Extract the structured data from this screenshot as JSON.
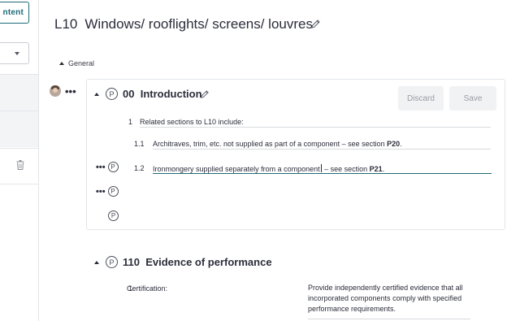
{
  "sidebar": {
    "top_button_label": "ntent"
  },
  "document": {
    "code": "L10",
    "title": "Windows/ rooflights/ screens/ louvres"
  },
  "group": {
    "label": "General"
  },
  "clause_intro": {
    "p_symbol": "P",
    "number": "00",
    "title": "Introduction",
    "discard_label": "Discard",
    "save_label": "Save",
    "item1_num": "1",
    "item1_text": "Related sections to L10 include:",
    "item11_num": "1.1",
    "item11_text": "Architraves, trim, etc. not supplied as part of a component – see section ",
    "item11_ref": "P20",
    "item11_end": ".",
    "item12_num": "1.2",
    "item12_text_a": "Ironmongery supplied separately from a component",
    "item12_text_b": " – see section ",
    "item12_ref": "P21",
    "item12_end": "."
  },
  "clause_110": {
    "p_symbol": "P",
    "number": "110",
    "title": "Evidence of performance",
    "item1_num": "1",
    "item1_label": "Certification:",
    "item1_text": "Provide independently certified evidence that all incorporated components comply with specified performance requirements."
  },
  "dots": "•••",
  "colors": {
    "accent": "#1f6a78",
    "text": "#2b2d3a",
    "border": "#e3e5ea",
    "button_bg": "#f1f2f4",
    "button_text": "#9a9ca6"
  }
}
